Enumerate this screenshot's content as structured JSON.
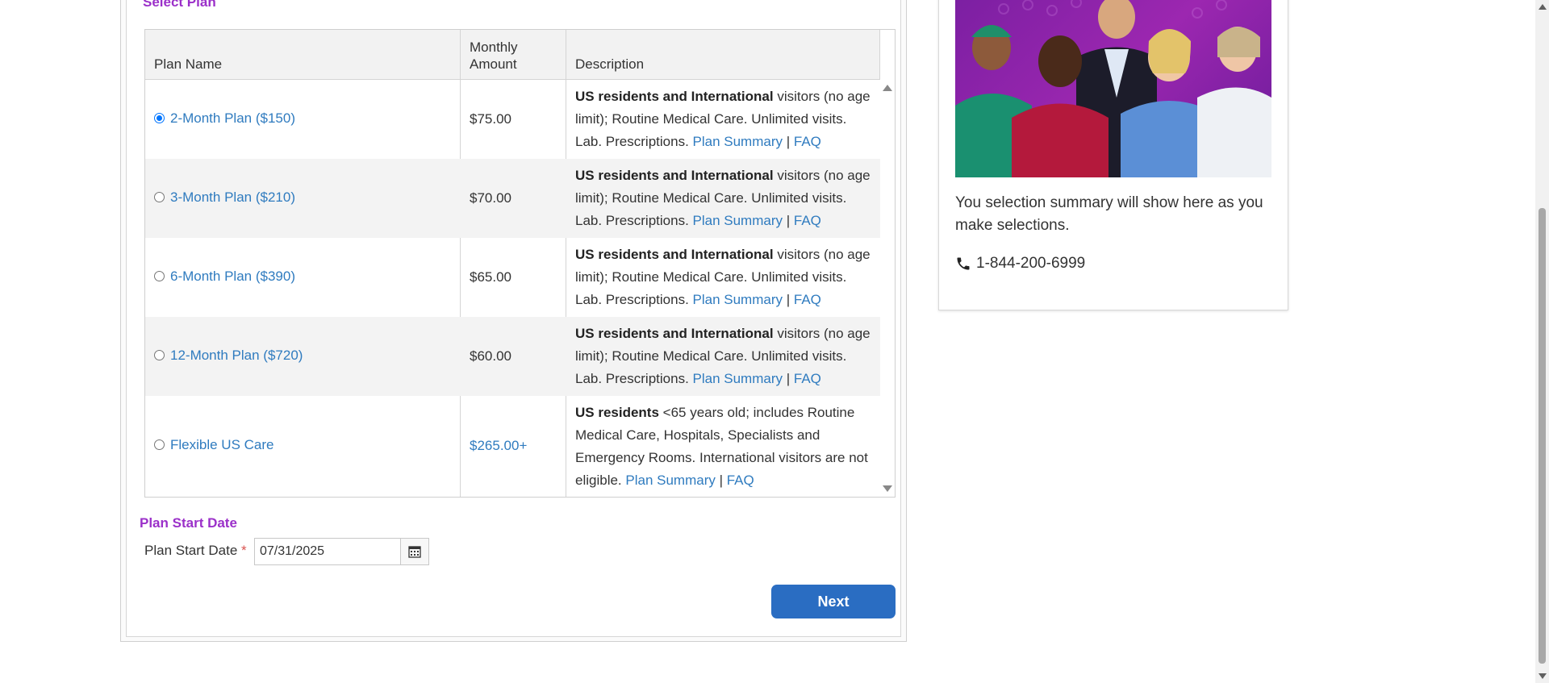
{
  "select_plan": {
    "title": "Select Plan",
    "columns": {
      "plan_name": "Plan Name",
      "monthly_amount_line1": "Monthly",
      "monthly_amount_line2": "Amount",
      "description": "Description"
    },
    "rows": [
      {
        "plan": "2-Month Plan ($150)",
        "amount": "$75.00",
        "selected": true,
        "desc_bold": "US residents and International",
        "desc_text": " visitors (no age limit); Routine Medical Care. Unlimited visits. Lab. Prescriptions. ",
        "plan_summary": "Plan Summary",
        "separator": " | ",
        "faq": "FAQ"
      },
      {
        "plan": "3-Month Plan ($210)",
        "amount": "$70.00",
        "selected": false,
        "desc_bold": "US residents and International",
        "desc_text": " visitors (no age limit); Routine Medical Care. Unlimited visits. Lab. Prescriptions. ",
        "plan_summary": "Plan Summary",
        "separator": " | ",
        "faq": "FAQ"
      },
      {
        "plan": "6-Month Plan ($390)",
        "amount": "$65.00",
        "selected": false,
        "desc_bold": "US residents and International",
        "desc_text": " visitors (no age limit); Routine Medical Care. Unlimited visits. Lab. Prescriptions. ",
        "plan_summary": "Plan Summary",
        "separator": " | ",
        "faq": "FAQ"
      },
      {
        "plan": "12-Month Plan ($720)",
        "amount": "$60.00",
        "selected": false,
        "desc_bold": "US residents and International",
        "desc_text": " visitors (no age limit); Routine Medical Care. Unlimited visits. Lab. Prescriptions. ",
        "plan_summary": "Plan Summary",
        "separator": " | ",
        "faq": "FAQ"
      },
      {
        "plan": "Flexible US Care",
        "amount": "$265.00+",
        "selected": false,
        "desc_bold": "US residents",
        "desc_text": " <65 years old; includes Routine Medical Care, Hospitals, Specialists and Emergency Rooms. International visitors are not eligible. ",
        "plan_summary": "Plan Summary",
        "separator": " | ",
        "faq": "FAQ"
      }
    ]
  },
  "start_date": {
    "title": "Plan Start Date",
    "label": "Plan Start Date",
    "required_mark": "*",
    "value": "07/31/2025"
  },
  "next_button": "Next",
  "sidebar": {
    "summary": "You selection summary will show here as you make selections.",
    "phone": "1-844-200-6999"
  },
  "colors": {
    "section_title": "#9b30c9",
    "link": "#2f7bbf",
    "next_button": "#2a6dc2",
    "hero_background": "#8e24aa"
  },
  "icons": {
    "calendar": "calendar-icon",
    "phone": "phone-icon"
  }
}
